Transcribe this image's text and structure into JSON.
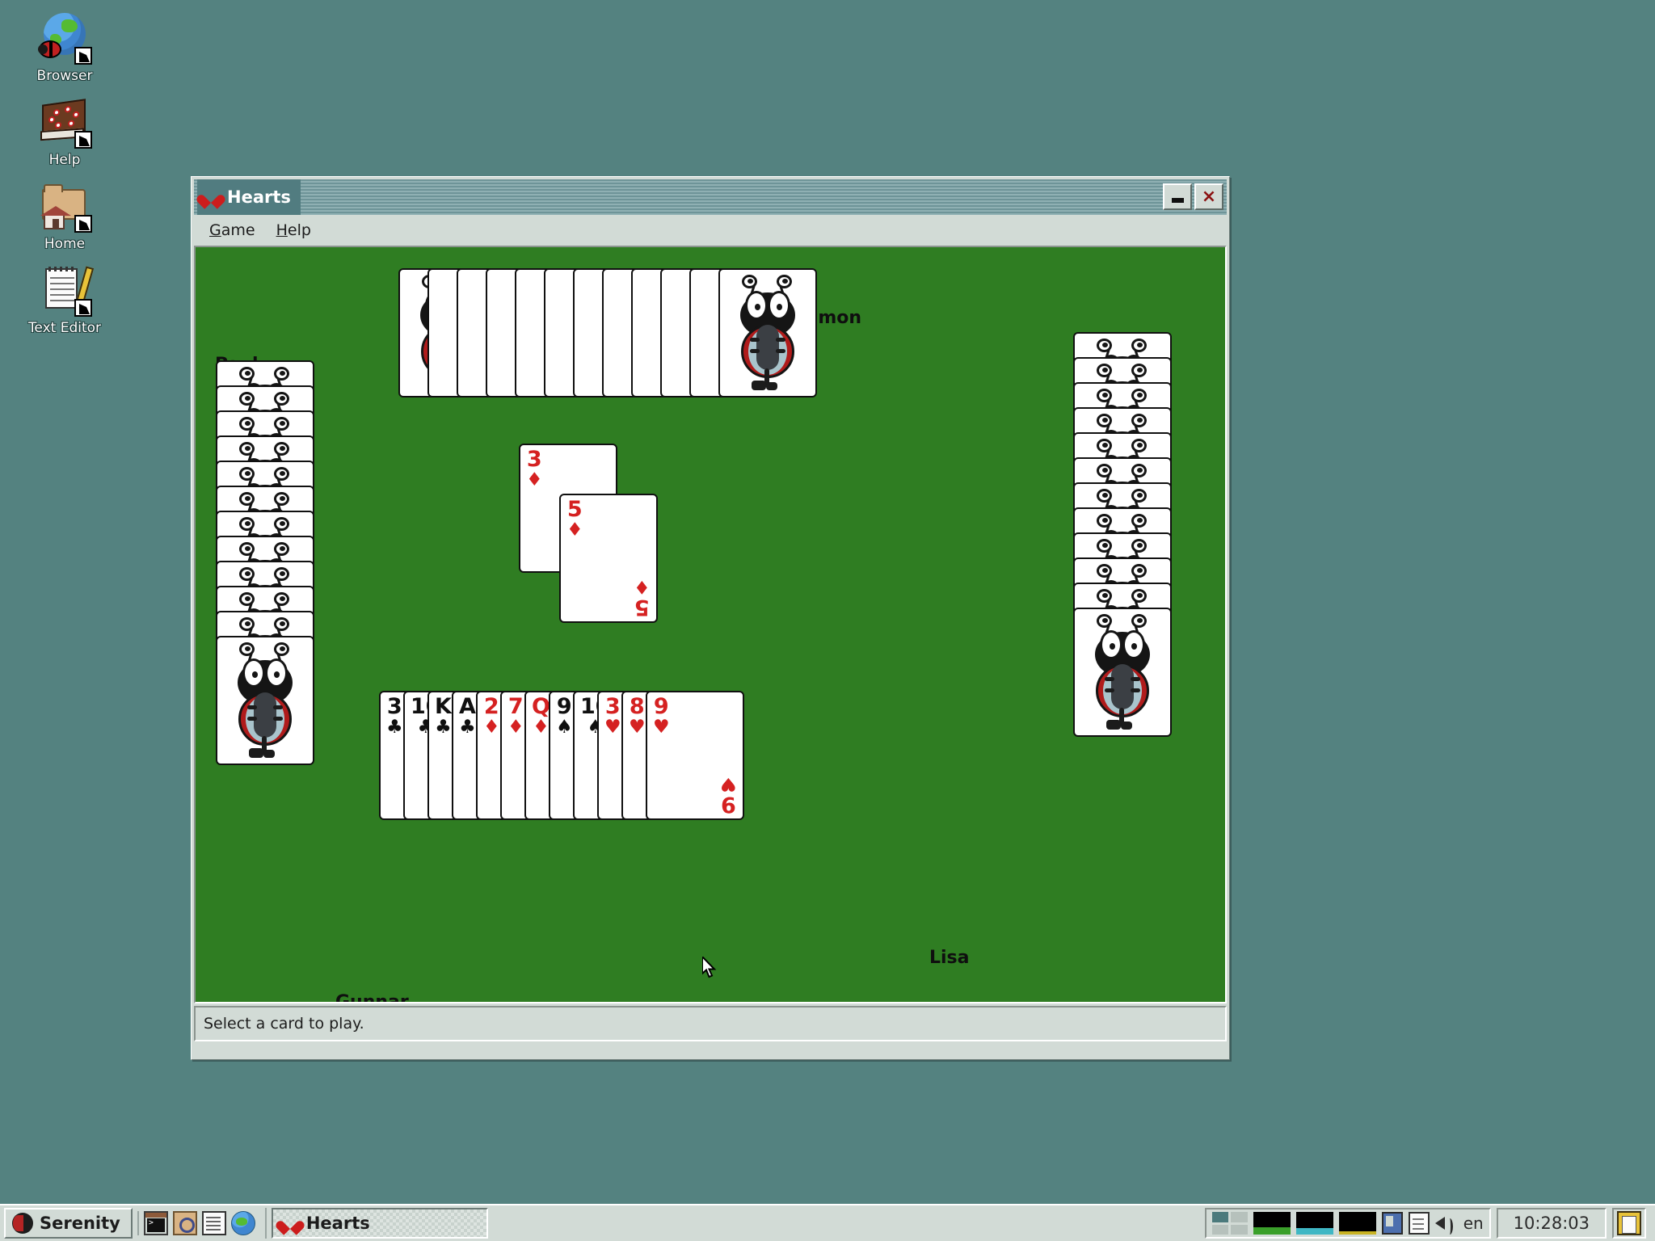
{
  "desktop": {
    "background_color": "#548280",
    "icons": [
      {
        "label": "Browser",
        "icon": "globe-ladybug-icon"
      },
      {
        "label": "Help",
        "icon": "book-icon"
      },
      {
        "label": "Home",
        "icon": "folder-house-icon"
      },
      {
        "label": "Text Editor",
        "icon": "notepad-pencil-icon"
      }
    ]
  },
  "window": {
    "title": "Hearts",
    "title_icon": "heart-icon",
    "minimize_label": "–",
    "close_label": "×",
    "menus": [
      {
        "label": "Game",
        "accel": "G"
      },
      {
        "label": "Help",
        "accel": "H"
      }
    ],
    "status_text": "Select a card to play.",
    "felt_color": "#2f7d22"
  },
  "game": {
    "players": [
      {
        "name": "Paul",
        "position": "left",
        "cards_remaining": 12,
        "hand_face": "down"
      },
      {
        "name": "Simon",
        "position": "top",
        "cards_remaining": 12,
        "hand_face": "down"
      },
      {
        "name": "Lisa",
        "position": "right",
        "cards_remaining": 12,
        "hand_face": "down"
      },
      {
        "name": "Gunnar",
        "position": "bottom",
        "cards_remaining": 12,
        "hand_face": "up"
      }
    ],
    "played_cards": [
      {
        "rank": "3",
        "suit": "♦",
        "suit_name": "diamonds",
        "color": "red"
      },
      {
        "rank": "5",
        "suit": "♦",
        "suit_name": "diamonds",
        "color": "red"
      }
    ],
    "player_hand": [
      {
        "rank": "3",
        "suit": "♣",
        "suit_name": "clubs",
        "color": "black"
      },
      {
        "rank": "10",
        "suit": "♣",
        "suit_name": "clubs",
        "color": "black"
      },
      {
        "rank": "K",
        "suit": "♣",
        "suit_name": "clubs",
        "color": "black"
      },
      {
        "rank": "A",
        "suit": "♣",
        "suit_name": "clubs",
        "color": "black"
      },
      {
        "rank": "2",
        "suit": "♦",
        "suit_name": "diamonds",
        "color": "red"
      },
      {
        "rank": "7",
        "suit": "♦",
        "suit_name": "diamonds",
        "color": "red"
      },
      {
        "rank": "Q",
        "suit": "♦",
        "suit_name": "diamonds",
        "color": "red"
      },
      {
        "rank": "9",
        "suit": "♠",
        "suit_name": "spades",
        "color": "black"
      },
      {
        "rank": "10",
        "suit": "♠",
        "suit_name": "spades",
        "color": "black"
      },
      {
        "rank": "3",
        "suit": "♥",
        "suit_name": "hearts",
        "color": "red"
      },
      {
        "rank": "8",
        "suit": "♥",
        "suit_name": "hearts",
        "color": "red"
      },
      {
        "rank": "9",
        "suit": "♥",
        "suit_name": "hearts",
        "color": "red"
      }
    ]
  },
  "taskbar": {
    "start_label": "Serenity",
    "start_icon": "serenity-logo-icon",
    "quick_launch": [
      {
        "icon": "terminal-icon"
      },
      {
        "icon": "file-manager-icon"
      },
      {
        "icon": "text-editor-icon"
      },
      {
        "icon": "browser-icon"
      }
    ],
    "tasks": [
      {
        "label": "Hearts",
        "icon": "heart-icon",
        "active": true
      }
    ],
    "tray": {
      "workspaces": {
        "rows": 2,
        "cols": 2,
        "active_index": 0
      },
      "graphs": [
        {
          "name": "cpu-graph",
          "color": "#3aa02a"
        },
        {
          "name": "memory-graph",
          "color": "#3fb7c4"
        },
        {
          "name": "network-graph",
          "color": "#c9b423"
        }
      ],
      "icons": [
        {
          "icon": "resource-monitor-icon"
        },
        {
          "icon": "clipboard-icon"
        },
        {
          "icon": "audio-volume-icon"
        }
      ],
      "keyboard_layout": "en",
      "clock": "10:28:03",
      "notepad_icon": "notepad-icon"
    }
  }
}
